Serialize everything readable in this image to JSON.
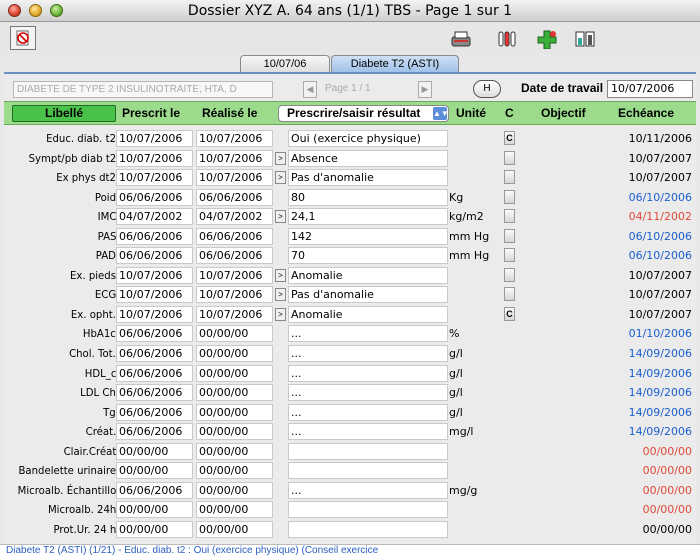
{
  "window": {
    "title": "Dossier XYZ A. 64 ans (1/1) TBS - Page 1 sur 1"
  },
  "toolbar": {
    "left_icon": "no-entry-document-icon",
    "right_icons": [
      "typewriter-icon",
      "lab-tubes-icon",
      "medical-cross-icon",
      "battery-chart-icon"
    ]
  },
  "tabs": [
    {
      "label": "10/07/06",
      "active": false
    },
    {
      "label": "Diabete T2 (ASTI)",
      "active": true
    }
  ],
  "header_bar": {
    "diagnosis": "DIABETE DE TYPE 2 INSULINOTRAITE, HTA, D",
    "page_indicator": "Page 1 / 1",
    "prev_symbol": "◀",
    "next_symbol": "▶",
    "h_button": "H",
    "date_label": "Date de travail",
    "date_value": "10/07/2006"
  },
  "columns": {
    "libelle": "Libellé",
    "prescrit": "Prescrit le",
    "realise": "Réalisé le",
    "resultat": "Prescrire/saisir résultat",
    "unite": "Unité",
    "c": "C",
    "objectif": "Objectif",
    "echeance": "Echéance"
  },
  "colors": {
    "blue": "#1a5fd0",
    "red": "#e04a3a",
    "black": "#000000",
    "header_green": "#9bdb8b",
    "button_green": "#4ac24a"
  },
  "rows": [
    {
      "label": "Educ. diab. t2",
      "prescrit": "10/07/2006",
      "realise": "10/07/2006",
      "arrow": false,
      "result": "Oui (exercice physique)",
      "unit": "",
      "c": "C",
      "echeance": "10/11/2006",
      "color": "black"
    },
    {
      "label": "Sympt/pb diab t2",
      "prescrit": "10/07/2006",
      "realise": "10/07/2006",
      "arrow": true,
      "result": "Absence",
      "unit": "",
      "c": "",
      "echeance": "10/07/2007",
      "color": "black"
    },
    {
      "label": "Ex phys dt2",
      "prescrit": "10/07/2006",
      "realise": "10/07/2006",
      "arrow": true,
      "result": "Pas d'anomalie",
      "unit": "",
      "c": "",
      "echeance": "10/07/2007",
      "color": "black"
    },
    {
      "label": "Poid",
      "prescrit": "06/06/2006",
      "realise": "06/06/2006",
      "arrow": false,
      "result": "80",
      "unit": "Kg",
      "c": "",
      "echeance": "06/10/2006",
      "color": "blue"
    },
    {
      "label": "IMC",
      "prescrit": "04/07/2002",
      "realise": "04/07/2002",
      "arrow": true,
      "result": "24,1",
      "unit": "kg/m2",
      "c": "",
      "echeance": "04/11/2002",
      "color": "red"
    },
    {
      "label": "PAS",
      "prescrit": "06/06/2006",
      "realise": "06/06/2006",
      "arrow": false,
      "result": "142",
      "unit": "mm Hg",
      "c": "",
      "echeance": "06/10/2006",
      "color": "blue"
    },
    {
      "label": "PAD",
      "prescrit": "06/06/2006",
      "realise": "06/06/2006",
      "arrow": false,
      "result": "70",
      "unit": "mm Hg",
      "c": "",
      "echeance": "06/10/2006",
      "color": "blue"
    },
    {
      "label": "Ex. pieds",
      "prescrit": "10/07/2006",
      "realise": "10/07/2006",
      "arrow": true,
      "result": "Anomalie",
      "unit": "",
      "c": "",
      "echeance": "10/07/2007",
      "color": "black"
    },
    {
      "label": "ECG",
      "prescrit": "10/07/2006",
      "realise": "10/07/2006",
      "arrow": true,
      "result": "Pas d'anomalie",
      "unit": "",
      "c": "",
      "echeance": "10/07/2007",
      "color": "black"
    },
    {
      "label": "Ex. opht.",
      "prescrit": "10/07/2006",
      "realise": "10/07/2006",
      "arrow": true,
      "result": "Anomalie",
      "unit": "",
      "c": "C",
      "echeance": "10/07/2007",
      "color": "black"
    },
    {
      "label": "HbA1c",
      "prescrit": "06/06/2006",
      "realise": "00/00/00",
      "arrow": false,
      "result": "...",
      "unit": "%",
      "c": null,
      "echeance": "01/10/2006",
      "color": "blue"
    },
    {
      "label": "Chol. Tot.",
      "prescrit": "06/06/2006",
      "realise": "00/00/00",
      "arrow": false,
      "result": "...",
      "unit": "g/l",
      "c": null,
      "echeance": "14/09/2006",
      "color": "blue"
    },
    {
      "label": "HDL_c",
      "prescrit": "06/06/2006",
      "realise": "00/00/00",
      "arrow": false,
      "result": "...",
      "unit": "g/l",
      "c": null,
      "echeance": "14/09/2006",
      "color": "blue"
    },
    {
      "label": "LDL Ch",
      "prescrit": "06/06/2006",
      "realise": "00/00/00",
      "arrow": false,
      "result": "...",
      "unit": "g/l",
      "c": null,
      "echeance": "14/09/2006",
      "color": "blue"
    },
    {
      "label": "Tg",
      "prescrit": "06/06/2006",
      "realise": "00/00/00",
      "arrow": false,
      "result": "...",
      "unit": "g/l",
      "c": null,
      "echeance": "14/09/2006",
      "color": "blue"
    },
    {
      "label": "Créat.",
      "prescrit": "06/06/2006",
      "realise": "00/00/00",
      "arrow": false,
      "result": "...",
      "unit": "mg/l",
      "c": null,
      "echeance": "14/09/2006",
      "color": "blue"
    },
    {
      "label": "Clair.Créat",
      "prescrit": "00/00/00",
      "realise": "00/00/00",
      "arrow": false,
      "result": "",
      "unit": "",
      "c": null,
      "echeance": "00/00/00",
      "color": "red"
    },
    {
      "label": "Bandelette urinaire",
      "prescrit": "00/00/00",
      "realise": "00/00/00",
      "arrow": false,
      "result": "",
      "unit": "",
      "c": null,
      "echeance": "00/00/00",
      "color": "red"
    },
    {
      "label": "Microalb. Échantillo",
      "prescrit": "06/06/2006",
      "realise": "00/00/00",
      "arrow": false,
      "result": "...",
      "unit": "mg/g",
      "c": null,
      "echeance": "00/00/00",
      "color": "red"
    },
    {
      "label": "Microalb. 24h",
      "prescrit": "00/00/00",
      "realise": "00/00/00",
      "arrow": false,
      "result": "",
      "unit": "",
      "c": null,
      "echeance": "00/00/00",
      "color": "red"
    },
    {
      "label": "Prot.Ur. 24 h",
      "prescrit": "00/00/00",
      "realise": "00/00/00",
      "arrow": false,
      "result": "",
      "unit": "",
      "c": null,
      "echeance": "00/00/00",
      "color": "black"
    }
  ],
  "status": "Diabete T2 (ASTI) (1/21) - Educ. diab. t2 : Oui (exercice physique) (Conseil exercice"
}
